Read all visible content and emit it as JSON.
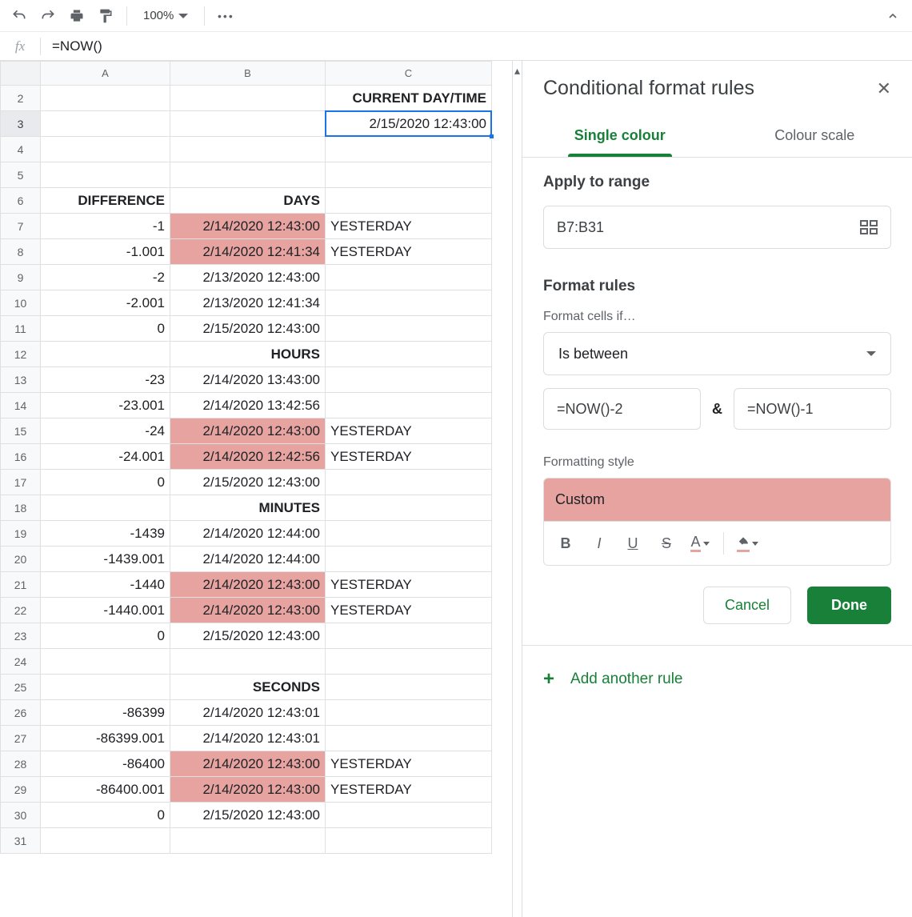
{
  "toolbar": {
    "zoom": "100%"
  },
  "formula": "=NOW()",
  "columns": [
    "A",
    "B",
    "C"
  ],
  "rows": [
    {
      "n": 2,
      "A": "",
      "B": "",
      "C": "CURRENT DAY/TIME",
      "boldC": true,
      "alignC": "right"
    },
    {
      "n": 3,
      "A": "",
      "B": "",
      "C": "2/15/2020 12:43:00",
      "alignC": "right",
      "selected": true
    },
    {
      "n": 4
    },
    {
      "n": 5
    },
    {
      "n": 6,
      "A": "DIFFERENCE",
      "B": "DAYS",
      "boldA": true,
      "boldB": true
    },
    {
      "n": 7,
      "A": "-1",
      "B": "2/14/2020 12:43:00",
      "C": "YESTERDAY",
      "hlB": true
    },
    {
      "n": 8,
      "A": "-1.001",
      "B": "2/14/2020 12:41:34",
      "C": "YESTERDAY",
      "hlB": true
    },
    {
      "n": 9,
      "A": "-2",
      "B": "2/13/2020 12:43:00"
    },
    {
      "n": 10,
      "A": "-2.001",
      "B": "2/13/2020 12:41:34"
    },
    {
      "n": 11,
      "A": "0",
      "B": "2/15/2020 12:43:00"
    },
    {
      "n": 12,
      "B": "HOURS",
      "boldB": true
    },
    {
      "n": 13,
      "A": "-23",
      "B": "2/14/2020 13:43:00"
    },
    {
      "n": 14,
      "A": "-23.001",
      "B": "2/14/2020 13:42:56"
    },
    {
      "n": 15,
      "A": "-24",
      "B": "2/14/2020 12:43:00",
      "C": "YESTERDAY",
      "hlB": true
    },
    {
      "n": 16,
      "A": "-24.001",
      "B": "2/14/2020 12:42:56",
      "C": "YESTERDAY",
      "hlB": true
    },
    {
      "n": 17,
      "A": "0",
      "B": "2/15/2020 12:43:00"
    },
    {
      "n": 18,
      "B": "MINUTES",
      "boldB": true
    },
    {
      "n": 19,
      "A": "-1439",
      "B": "2/14/2020 12:44:00"
    },
    {
      "n": 20,
      "A": "-1439.001",
      "B": "2/14/2020 12:44:00"
    },
    {
      "n": 21,
      "A": "-1440",
      "B": "2/14/2020 12:43:00",
      "C": "YESTERDAY",
      "hlB": true
    },
    {
      "n": 22,
      "A": "-1440.001",
      "B": "2/14/2020 12:43:00",
      "C": "YESTERDAY",
      "hlB": true
    },
    {
      "n": 23,
      "A": "0",
      "B": "2/15/2020 12:43:00"
    },
    {
      "n": 24
    },
    {
      "n": 25,
      "B": "SECONDS",
      "boldB": true
    },
    {
      "n": 26,
      "A": "-86399",
      "B": "2/14/2020 12:43:01"
    },
    {
      "n": 27,
      "A": "-86399.001",
      "B": "2/14/2020 12:43:01"
    },
    {
      "n": 28,
      "A": "-86400",
      "B": "2/14/2020 12:43:00",
      "C": "YESTERDAY",
      "hlB": true
    },
    {
      "n": 29,
      "A": "-86400.001",
      "B": "2/14/2020 12:43:00",
      "C": "YESTERDAY",
      "hlB": true
    },
    {
      "n": 30,
      "A": "0",
      "B": "2/15/2020 12:43:00"
    },
    {
      "n": 31
    }
  ],
  "panel": {
    "title": "Conditional format rules",
    "tabs": {
      "single": "Single colour",
      "scale": "Colour scale"
    },
    "applyLabel": "Apply to range",
    "range": "B7:B31",
    "formatRulesLabel": "Format rules",
    "formatCellsIf": "Format cells if…",
    "condition": "Is between",
    "value1": "=NOW()-2",
    "amp": "&",
    "value2": "=NOW()-1",
    "styleLabel": "Formatting style",
    "stylePreview": "Custom",
    "cancel": "Cancel",
    "done": "Done",
    "addRule": "Add another rule"
  }
}
